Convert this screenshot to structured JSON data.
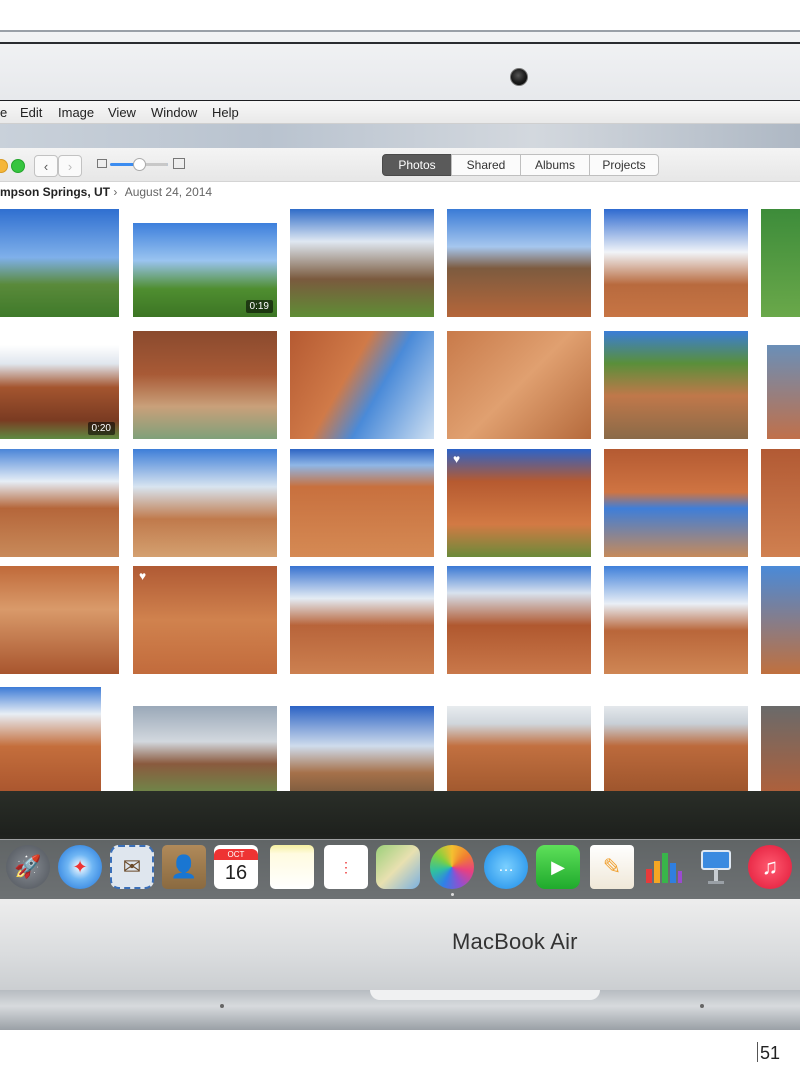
{
  "menubar": {
    "items": [
      "e",
      "Edit",
      "Image",
      "View",
      "Window",
      "Help"
    ]
  },
  "toolbar": {
    "tabs": [
      {
        "label": "Photos",
        "active": true
      },
      {
        "label": "Shared",
        "active": false
      },
      {
        "label": "Albums",
        "active": false
      },
      {
        "label": "Projects",
        "active": false
      }
    ],
    "back_glyph": "‹",
    "forward_glyph": "›"
  },
  "breadcrumb": {
    "location": "mpson Springs, UT",
    "separator": "›",
    "date": "August 24, 2014"
  },
  "photos": {
    "durations": [
      "0:19",
      "0:20"
    ],
    "heart_glyph": "♥"
  },
  "dock": {
    "calendar_month": "OCT",
    "calendar_day": "16",
    "icons": [
      "launchpad-icon",
      "safari-icon",
      "mail-icon",
      "contacts-icon",
      "calendar-icon",
      "notes-icon",
      "reminders-icon",
      "maps-icon",
      "photos-icon",
      "messages-icon",
      "facetime-icon",
      "pages-icon",
      "numbers-icon",
      "keynote-icon",
      "itunes-icon"
    ]
  },
  "device": {
    "brand": "MacBook Air"
  },
  "page_number": "51"
}
